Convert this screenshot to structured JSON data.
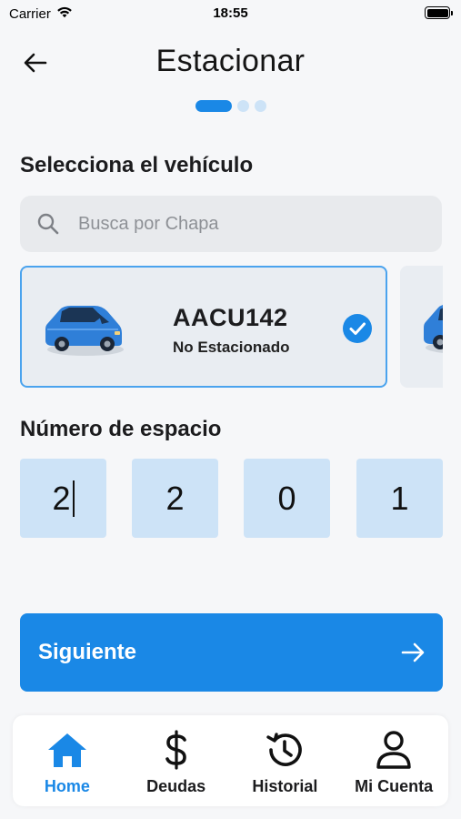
{
  "status_bar": {
    "carrier": "Carrier",
    "time": "18:55",
    "wifi_icon": "wifi-icon",
    "battery_icon": "battery-full-icon"
  },
  "header": {
    "title": "Estacionar",
    "back_icon": "arrow-left-icon"
  },
  "steps": {
    "total": 3,
    "current": 1
  },
  "vehicle_section": {
    "label": "Selecciona el vehículo",
    "search": {
      "placeholder": "Busca por Chapa",
      "value": ""
    },
    "vehicles": [
      {
        "plate": "AACU142",
        "status": "No Estacionado",
        "selected": true,
        "icon": "car-icon"
      }
    ]
  },
  "space_section": {
    "label": "Número de espacio",
    "digits": [
      "2",
      "2",
      "0",
      "1"
    ],
    "focused_index": 0
  },
  "next_button": {
    "label": "Siguiente",
    "icon": "arrow-right-icon"
  },
  "tabbar": {
    "items": [
      {
        "label": "Home",
        "icon": "home-icon",
        "active": true
      },
      {
        "label": "Deudas",
        "icon": "dollar-icon",
        "active": false
      },
      {
        "label": "Historial",
        "icon": "history-icon",
        "active": false
      },
      {
        "label": "Mi Cuenta",
        "icon": "user-icon",
        "active": false
      }
    ]
  },
  "colors": {
    "accent": "#1a88e6",
    "accent_light": "#cde3f7",
    "background": "#f6f7f9",
    "card_background": "#e9edf2"
  }
}
